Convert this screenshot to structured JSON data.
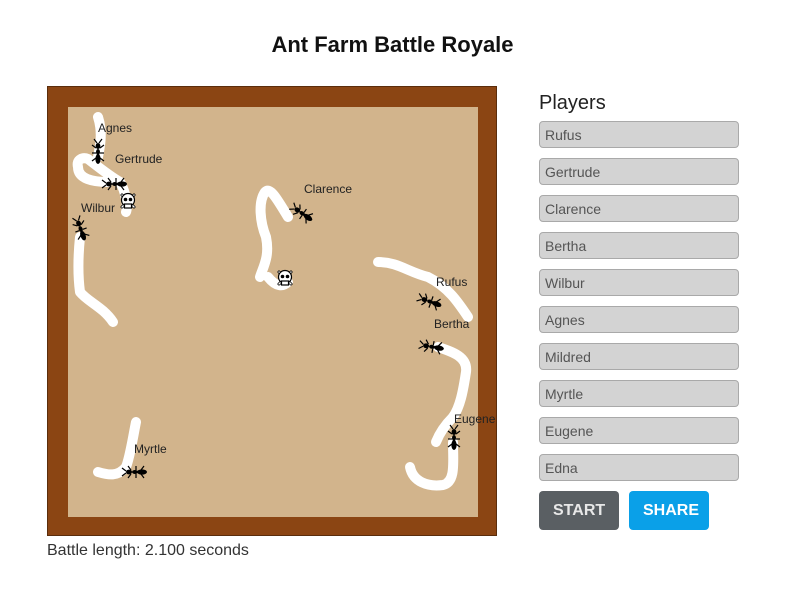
{
  "title": "Ant Farm Battle Royale",
  "battle_length": "Battle length: 2.100 seconds",
  "players_heading": "Players",
  "players": [
    "Rufus",
    "Gertrude",
    "Clarence",
    "Bertha",
    "Wilbur",
    "Agnes",
    "Mildred",
    "Myrtle",
    "Eugene",
    "Edna"
  ],
  "buttons": {
    "start": "START",
    "share": "SHARE"
  },
  "ant_labels": {
    "agnes": "Agnes",
    "gertrude": "Gertrude",
    "wilbur": "Wilbur",
    "clarence": "Clarence",
    "rufus": "Rufus",
    "bertha": "Bertha",
    "myrtle": "Myrtle",
    "eugene": "Eugene"
  },
  "icons": {
    "dead_marker": "skull-icon",
    "ant": "ant-icon"
  },
  "colors": {
    "frame": "#8b4513",
    "sand": "#d2b48c",
    "trail": "#ffffff",
    "start_button": "#5a5f63",
    "share_button": "#0aa0e8",
    "input_bg": "#d3d3d3"
  }
}
